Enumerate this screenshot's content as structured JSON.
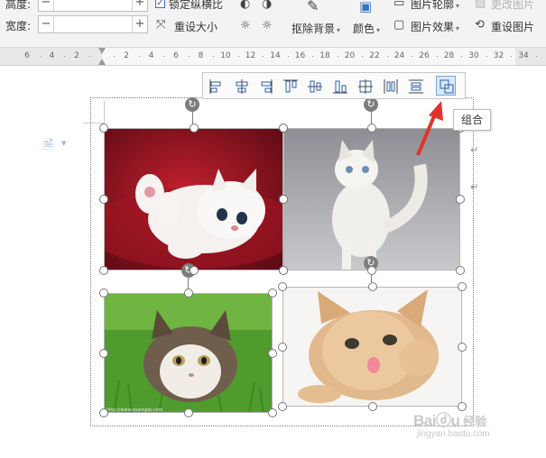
{
  "ribbon": {
    "height_label": "高度:",
    "width_label": "宽度:",
    "minus": "−",
    "plus": "+",
    "lock_ratio": "锁定纵横比",
    "reset_size": "重设大小",
    "remove_bg": "抠除背景",
    "color": "颜色",
    "picture_outline": "图片轮廓",
    "picture_effect": "图片效果",
    "change_picture": "更改图片",
    "reset_picture": "重设图片"
  },
  "ruler": {
    "ticks": [
      "6",
      "4",
      "2",
      "",
      "2",
      "4",
      "6",
      "8",
      "10",
      "12",
      "14",
      "16",
      "18",
      "20",
      "22",
      "24",
      "26",
      "28",
      "30",
      "32",
      "34"
    ]
  },
  "float_toolbar": {
    "buttons": [
      "align-left",
      "align-center",
      "align-right",
      "align-top",
      "align-middle",
      "align-bottom",
      "distribute-grid",
      "distribute-horizontal",
      "distribute-vertical",
      "group"
    ],
    "active": "group"
  },
  "tooltip": {
    "text": "组合"
  },
  "photo_credit": "http://www.example.com",
  "watermark": {
    "brand": "Bai",
    "brand_cn": "经验",
    "url": "jingyan.baidu.com"
  },
  "colors": {
    "accent": "#3b73b9",
    "arrow": "#e3322b",
    "handle_border": "#777777"
  }
}
